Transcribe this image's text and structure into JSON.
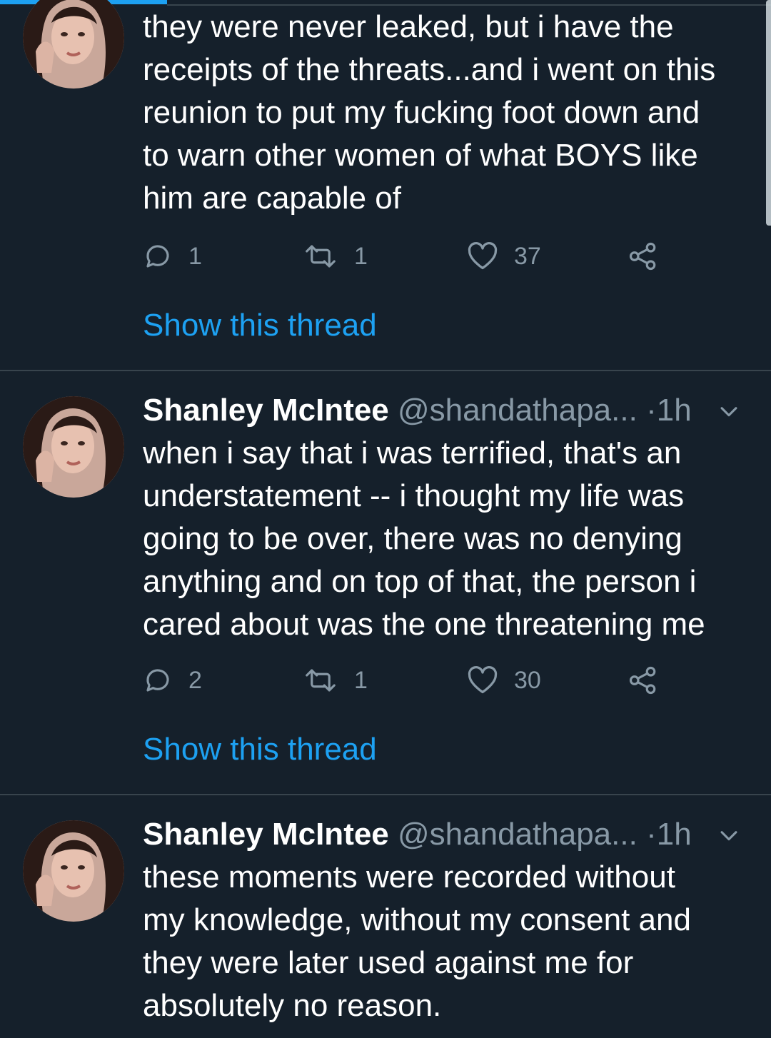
{
  "tweets": [
    {
      "name": "",
      "handle": "",
      "time": "",
      "text": "they were never leaked, but i have the\nreceipts of the threats...and i went on this\nreunion to put my fucking foot down and\nto warn other women of what BOYS like\nhim are capable of",
      "replies": "1",
      "retweets": "1",
      "likes": "37",
      "show_thread": "Show this thread"
    },
    {
      "name": "Shanley McIntee",
      "handle": "@shandathapa...",
      "separator": "·",
      "time": "1h",
      "text": "when i say that i was terrified, that's an\nunderstatement -- i thought my life was\ngoing to be over, there was no denying\nanything and on top of that, the person i\ncared about was the one threatening me",
      "replies": "2",
      "retweets": "1",
      "likes": "30",
      "show_thread": "Show this thread"
    },
    {
      "name": "Shanley McIntee",
      "handle": "@shandathapa...",
      "separator": "·",
      "time": "1h",
      "text": "these moments were recorded without\nmy knowledge, without my consent and\nthey were later used against me for\nabsolutely no reason."
    }
  ],
  "colors": {
    "background": "#15202b",
    "text": "#ffffff",
    "muted": "#8899a6",
    "link": "#1da1f2",
    "divider": "#38444d"
  },
  "icons": [
    "reply-icon",
    "retweet-icon",
    "like-icon",
    "share-icon",
    "chevron-down-icon"
  ]
}
